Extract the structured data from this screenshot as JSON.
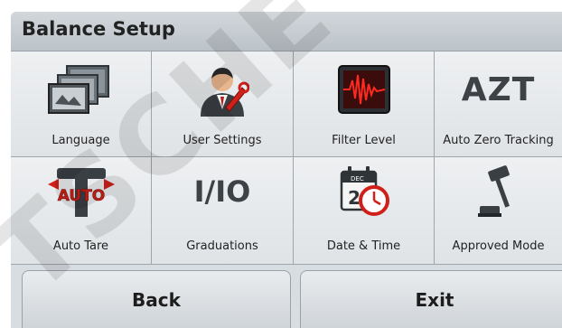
{
  "header": {
    "title": "Balance Setup"
  },
  "tiles": [
    {
      "label": "Language",
      "icon": "language-icon"
    },
    {
      "label": "User Settings",
      "icon": "user-settings-icon"
    },
    {
      "label": "Filter Level",
      "icon": "filter-level-icon"
    },
    {
      "label": "Auto Zero Tracking",
      "icon": "azt-icon"
    },
    {
      "label": "Auto Tare",
      "icon": "auto-tare-icon"
    },
    {
      "label": "Graduations",
      "icon": "graduations-icon"
    },
    {
      "label": "Date & Time",
      "icon": "date-time-icon"
    },
    {
      "label": "Approved Mode",
      "icon": "approved-mode-icon"
    }
  ],
  "icon_text": {
    "azt": "AZT",
    "auto": "AUTO",
    "graduations": "I/IO",
    "cal_month": "DEC",
    "cal_day": "2"
  },
  "buttons": {
    "back": "Back",
    "exit": "Exit"
  },
  "watermark": {
    "text": "TSCHE"
  },
  "colors": {
    "header": "#c6ccd2",
    "tile": "#e6e9ec",
    "accent_red": "#d0201a",
    "watermark": "#000000"
  }
}
